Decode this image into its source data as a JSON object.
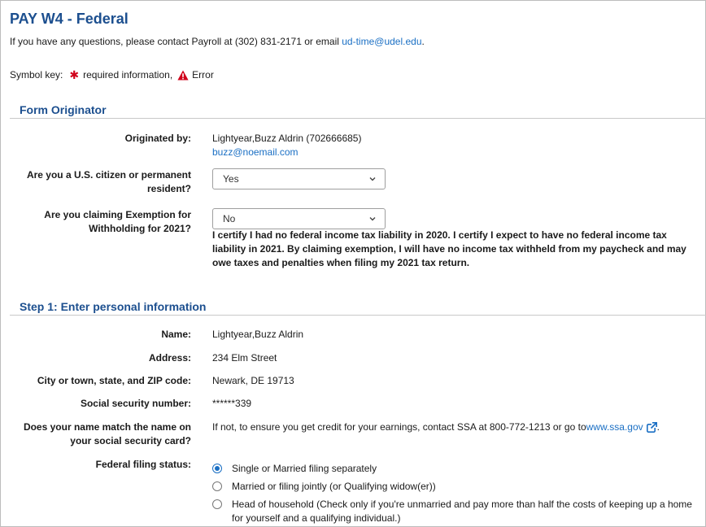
{
  "header": {
    "title": "PAY W4 - Federal",
    "contact_prefix": "If you have any questions, please contact Payroll at (302) 831-2171 or email ",
    "contact_email": "ud-time@udel.edu",
    "contact_suffix": "."
  },
  "symbol_key": {
    "label": "Symbol key:",
    "required_text": "required information,",
    "error_text": "Error"
  },
  "form_originator": {
    "section_title": "Form Originator",
    "originated_by_label": "Originated by:",
    "originator_name": "Lightyear,Buzz Aldrin (702666685)",
    "originator_email": "buzz@noemail.com",
    "citizen_label_1": "Are you a U.S. citizen or permanent",
    "citizen_label_2": "resident?",
    "citizen_value": "Yes",
    "exemption_label_1": "Are you claiming Exemption for",
    "exemption_label_2": "Withholding for 2021?",
    "exemption_value": "No",
    "certify_text": "I certify I had no federal income tax liability in 2020. I certify I expect to have no federal income tax liability in 2021. By claiming exemption, I will have no income tax withheld from my paycheck and may owe taxes and penalties when filing my 2021 tax return."
  },
  "step1": {
    "section_title": "Step 1: Enter personal information",
    "name_label": "Name:",
    "name_value": "Lightyear,Buzz Aldrin",
    "address_label": "Address:",
    "address_value": "234 Elm Street",
    "city_label": "City or town, state, and ZIP code:",
    "city_value": "Newark, DE 19713",
    "ssn_label": "Social security number:",
    "ssn_value": "******339",
    "name_match_label_1": "Does your name match the name on",
    "name_match_label_2": "your social security card?",
    "name_match_text": "If not, to ensure you get credit for your earnings, contact SSA at 800-772-1213 or go to ",
    "ssa_link": "www.ssa.gov",
    "name_match_suffix": ".",
    "filing_status_label": "Federal filing status:",
    "filing_options": [
      "Single or Married filing separately",
      "Married or filing jointly (or Qualifying widow(er))",
      "Head of household (Check only if you're unmarried and pay more than half the costs of keeping up a home for yourself and a qualifying individual.)"
    ],
    "filing_selected": "Single or Married filing separately"
  },
  "colors": {
    "heading": "#1c4f8f",
    "link": "#1a6fc4",
    "required": "#d0021b",
    "error": "#d0021b"
  },
  "icons": {
    "required": "asterisk-icon",
    "error": "warning-triangle-icon",
    "external": "external-link-icon",
    "select": "chevron-down-icon"
  }
}
